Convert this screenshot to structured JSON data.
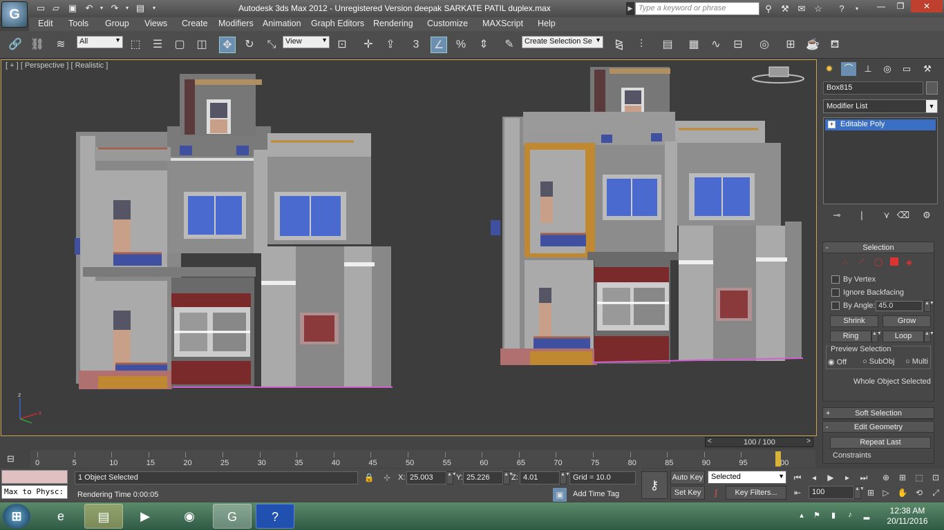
{
  "window": {
    "title": "Autodesk 3ds Max  2012  - Unregistered Version    deepak SARKATE PATIL duplex.max",
    "search_placeholder": "Type a keyword or phrase"
  },
  "menu": [
    "Edit",
    "Tools",
    "Group",
    "Views",
    "Create",
    "Modifiers",
    "Animation",
    "Graph Editors",
    "Rendering",
    "Customize",
    "MAXScript",
    "Help"
  ],
  "toolbar": {
    "selection_filter": "All",
    "ref_coord": "View",
    "named_selection": "Create Selection Se",
    "snap_label": "3"
  },
  "viewport": {
    "label": "[ + ] [ Perspective ] [ Realistic ]",
    "axis_z": "z",
    "axis_x": "x"
  },
  "command_panel": {
    "object_name": "Box815",
    "modifier_list": "Modifier List",
    "stack_item": "Editable Poly",
    "selection_rollout": {
      "title": "Selection",
      "by_vertex": "By Vertex",
      "ignore_backfacing": "Ignore Backfacing",
      "by_angle": "By Angle:",
      "angle_value": "45.0",
      "shrink": "Shrink",
      "grow": "Grow",
      "ring": "Ring",
      "loop": "Loop",
      "preview_selection": "Preview Selection",
      "preview_off": "Off",
      "preview_subobj": "SubObj",
      "preview_multi": "Multi",
      "status": "Whole Object Selected"
    },
    "soft_selection": "Soft Selection",
    "edit_geometry": "Edit Geometry",
    "repeat_last": "Repeat Last",
    "constraints": "Constraints"
  },
  "timeline": {
    "slider_label": "100 / 100",
    "ticks": [
      "0",
      "5",
      "10",
      "15",
      "20",
      "25",
      "30",
      "35",
      "40",
      "45",
      "50",
      "55",
      "60",
      "65",
      "70",
      "75",
      "80",
      "85",
      "90",
      "95",
      "100"
    ]
  },
  "status": {
    "maxscript": "Max to Physc:",
    "selected": "1 Object Selected",
    "rendering_time": "Rendering Time  0:00:05",
    "x_label": "X:",
    "x_value": "25.003",
    "y_label": "Y:",
    "y_value": "25.226",
    "z_label": "Z:",
    "z_value": "4.01",
    "grid": "Grid = 10.0",
    "add_time_tag": "Add Time Tag",
    "auto_key": "Auto Key",
    "set_key": "Set Key",
    "key_mode": "Selected",
    "key_filters": "Key Filters...",
    "frame": "100"
  },
  "taskbar": {
    "time": "12:38 AM",
    "date": "20/11/2016"
  }
}
